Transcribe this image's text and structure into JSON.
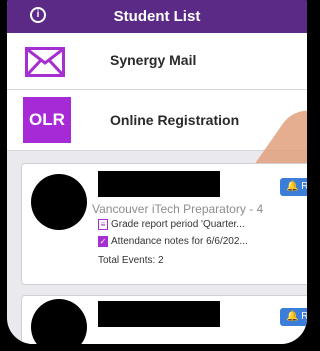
{
  "header": {
    "title": "Student List",
    "info_icon": "info-icon"
  },
  "menu": [
    {
      "label": "Synergy Mail",
      "icon": "mail-icon"
    },
    {
      "label": "Online Registration",
      "icon_text": "OLR"
    }
  ],
  "students": [
    {
      "school": "Vancouver iTech Preparatory - 4",
      "button_label": "R",
      "events": [
        {
          "icon": "grade-report-icon",
          "text": "Grade report period 'Quarter..."
        },
        {
          "icon": "checkbox-icon",
          "text": "Attendance notes for 6/6/202..."
        }
      ],
      "total_events": "Total Events: 2"
    },
    {
      "button_label": "R"
    }
  ],
  "colors": {
    "header": "#5b2a86",
    "accent": "#a52fd0",
    "button": "#3b7dd8"
  }
}
